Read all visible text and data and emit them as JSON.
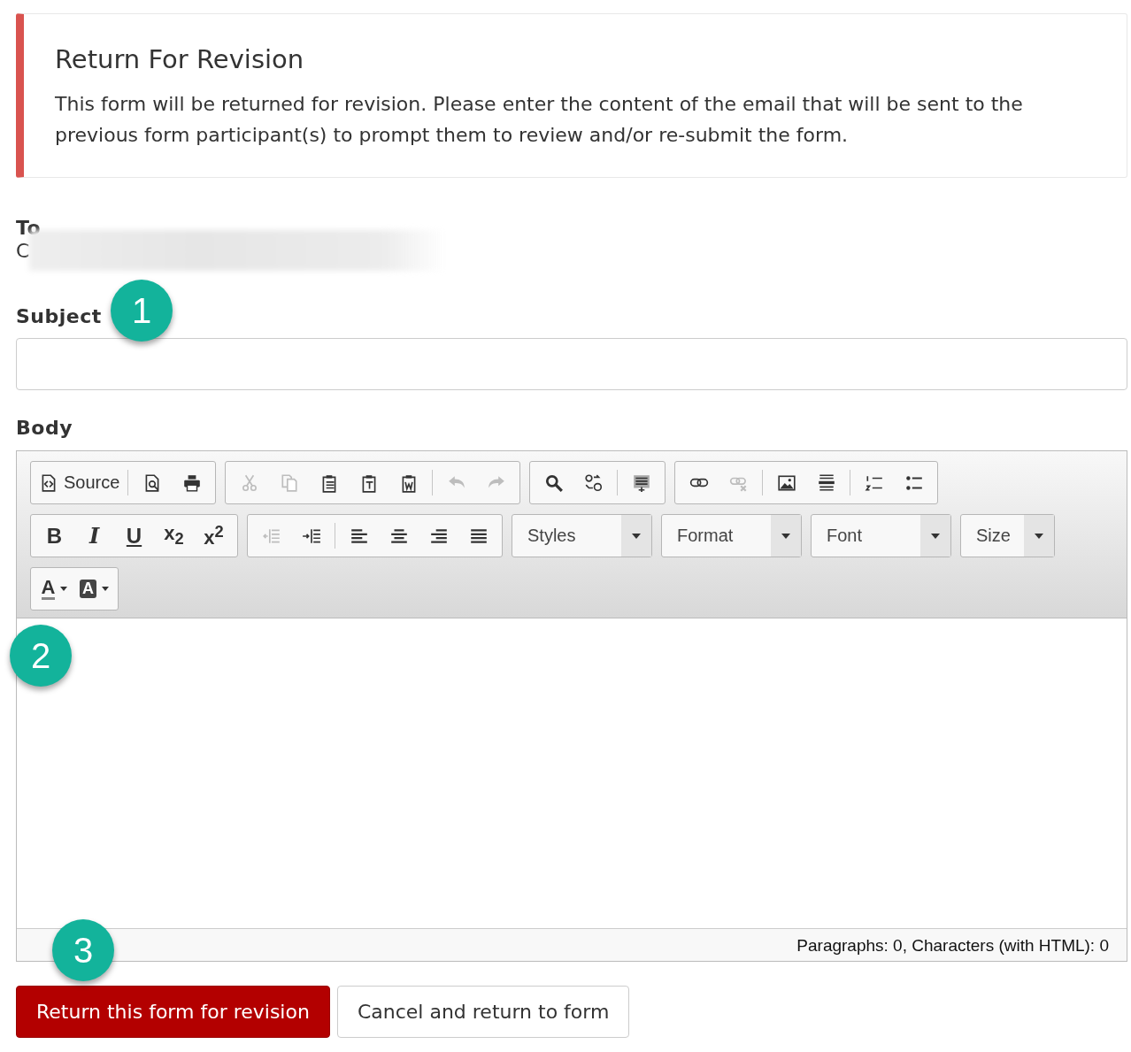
{
  "notice": {
    "title": "Return For Revision",
    "text": "This form will be returned for revision. Please enter the content of the email that will be sent to the previous form participant(s) to prompt them to review and/or re-submit the form."
  },
  "to": {
    "label": "To",
    "value": "C"
  },
  "subject": {
    "label": "Subject"
  },
  "body": {
    "label": "Body",
    "toolbar_rows": [
      [
        [
          {
            "kind": "source",
            "label": "Source",
            "disabled": false
          },
          {
            "kind": "separator"
          },
          {
            "kind": "preview",
            "disabled": false
          },
          {
            "kind": "print",
            "disabled": false
          }
        ],
        [
          {
            "kind": "cut",
            "disabled": true
          },
          {
            "kind": "copy",
            "disabled": true
          },
          {
            "kind": "paste",
            "disabled": false
          },
          {
            "kind": "paste-text",
            "disabled": false
          },
          {
            "kind": "paste-word",
            "disabled": false
          },
          {
            "kind": "separator"
          },
          {
            "kind": "undo",
            "disabled": true
          },
          {
            "kind": "redo",
            "disabled": true
          }
        ],
        [
          {
            "kind": "find",
            "disabled": false
          },
          {
            "kind": "replace",
            "disabled": false
          },
          {
            "kind": "separator"
          },
          {
            "kind": "select-all",
            "disabled": false
          }
        ],
        [
          {
            "kind": "link",
            "disabled": false
          },
          {
            "kind": "unlink",
            "disabled": true
          },
          {
            "kind": "separator"
          },
          {
            "kind": "image",
            "disabled": false
          },
          {
            "kind": "rule",
            "disabled": false
          },
          {
            "kind": "separator"
          },
          {
            "kind": "numbered-list",
            "disabled": false
          },
          {
            "kind": "bulleted-list",
            "disabled": false
          }
        ]
      ],
      [
        [
          {
            "kind": "bold",
            "label": "B",
            "disabled": false
          },
          {
            "kind": "italic",
            "label": "I",
            "disabled": false
          },
          {
            "kind": "underline",
            "label": "U",
            "disabled": false
          },
          {
            "kind": "subscript",
            "label": "x$_{2}$",
            "disabled": false
          },
          {
            "kind": "superscript",
            "label": "x$^{2}$",
            "disabled": false
          }
        ],
        [
          {
            "kind": "outdent",
            "disabled": true
          },
          {
            "kind": "indent",
            "disabled": false
          },
          {
            "kind": "separator"
          },
          {
            "kind": "align-left",
            "disabled": false
          },
          {
            "kind": "align-center",
            "disabled": false
          },
          {
            "kind": "align-right",
            "disabled": false
          },
          {
            "kind": "justify",
            "disabled": false
          }
        ],
        [
          {
            "kind": "combo",
            "label": "Styles",
            "small": false
          }
        ],
        [
          {
            "kind": "combo",
            "label": "Format",
            "small": false
          }
        ],
        [
          {
            "kind": "combo",
            "label": "Font",
            "small": false
          }
        ],
        [
          {
            "kind": "combo",
            "label": "Size",
            "small": true
          }
        ]
      ],
      [
        [
          {
            "kind": "text-color",
            "label": "A",
            "disabled": false
          },
          {
            "kind": "background-color",
            "label": "A",
            "disabled": false
          }
        ]
      ]
    ],
    "status": "Paragraphs: 0, Characters (with HTML): 0"
  },
  "buttons": [
    {
      "kind": "primary",
      "label": "Return this form for revision"
    },
    {
      "kind": "secondary",
      "label": "Cancel and return to form"
    }
  ],
  "callouts": [
    "1",
    "2",
    "3"
  ]
}
